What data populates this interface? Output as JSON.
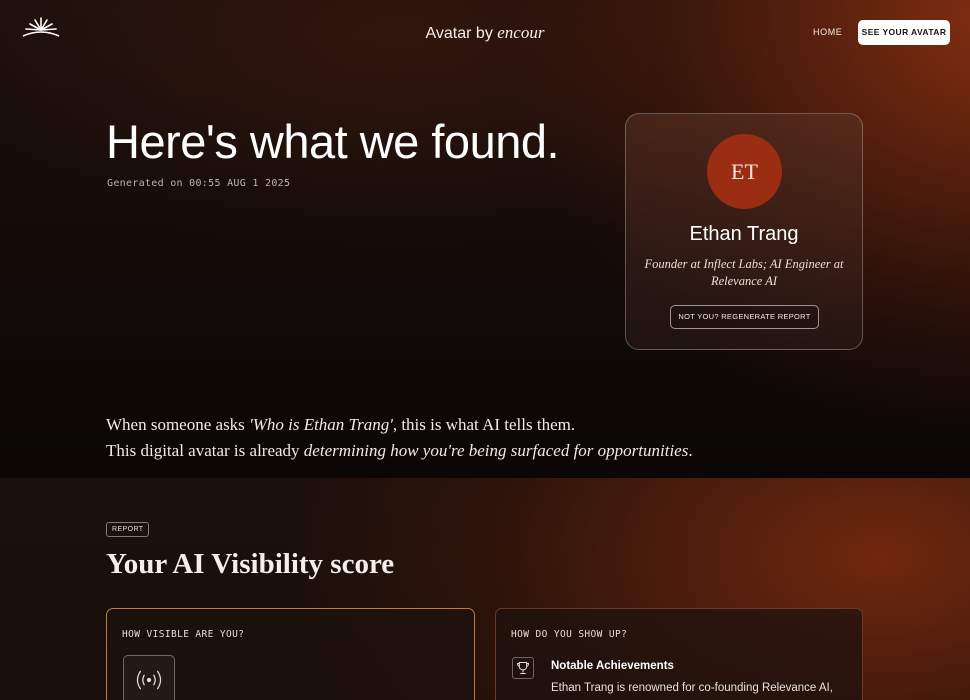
{
  "nav": {
    "brand_prefix": "Avatar by",
    "brand_mark": "encour",
    "home_label": "HOME",
    "cta_label": "SEE YOUR AVATAR"
  },
  "hero": {
    "headline": "Here's what we found.",
    "generated": "Generated on 00:55 AUG 1 2025"
  },
  "profile": {
    "initials": "ET",
    "name": "Ethan Trang",
    "title": "Founder at Inflect Labs; AI Engineer at Relevance AI",
    "regenerate_label": "NOT YOU? REGENERATE REPORT"
  },
  "intro": {
    "line1_pre": "When someone asks ",
    "line1_quote": "'Who is Ethan Trang'",
    "line1_post": ", this is what AI tells them.",
    "line2_pre": "This digital avatar is already ",
    "line2_em": "determining how you're being surfaced for opportunities",
    "line2_post": "."
  },
  "report": {
    "tag": "REPORT",
    "title": "Your AI Visibility score",
    "left_card": {
      "label": "HOW VISIBLE ARE YOU?",
      "icon": "signal-icon"
    },
    "right_card": {
      "label": "HOW DO YOU SHOW UP?",
      "icon": "trophy-icon",
      "item_title": "Notable Achievements",
      "item_text": "Ethan Trang is renowned for co-founding Relevance AI,"
    }
  },
  "colors": {
    "accent_orange": "#9b2d12",
    "card_border_gold": "#b97a45",
    "card_border_rust": "#6b3a26",
    "background": "#0c0807"
  }
}
